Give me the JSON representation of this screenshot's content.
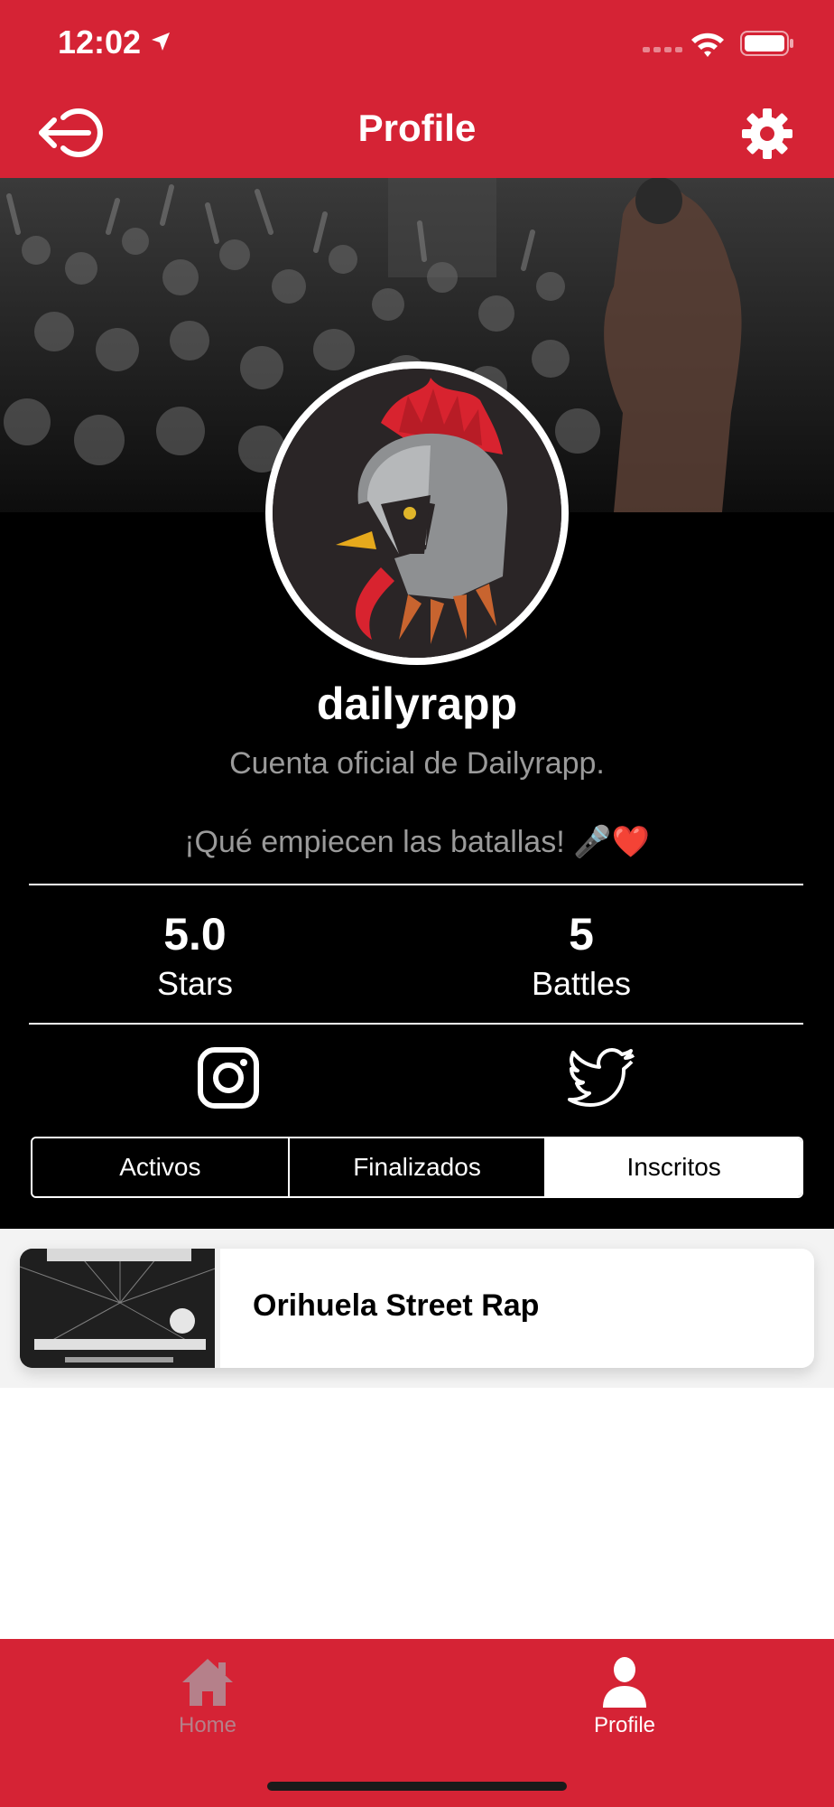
{
  "status_bar": {
    "time": "12:02",
    "location_icon": "location-arrow-icon",
    "wifi_icon": "wifi-icon",
    "battery_icon": "battery-icon"
  },
  "header": {
    "title": "Profile",
    "logout_icon": "logout-icon",
    "settings_icon": "gear-icon",
    "color": "#d52335"
  },
  "profile": {
    "username": "dailyrapp",
    "bio_line1": "Cuenta oficial de Dailyrapp.",
    "bio_line2": "¡Qué empiecen las batallas! 🎤❤️",
    "stats": {
      "stars_value": "5.0",
      "stars_label": "Stars",
      "battles_value": "5",
      "battles_label": "Battles"
    },
    "social": {
      "instagram_icon": "instagram-icon",
      "twitter_icon": "twitter-icon"
    }
  },
  "tabs": [
    {
      "label": "Activos",
      "active": false
    },
    {
      "label": "Finalizados",
      "active": false
    },
    {
      "label": "Inscritos",
      "active": true
    }
  ],
  "battles": [
    {
      "title": "Orihuela Street Rap",
      "thumbnail_icon": "event-poster-thumbnail"
    }
  ],
  "bottom_nav": {
    "items": [
      {
        "label": "Home",
        "icon": "home-icon",
        "active": false
      },
      {
        "label": "Profile",
        "icon": "user-icon",
        "active": true
      }
    ]
  }
}
